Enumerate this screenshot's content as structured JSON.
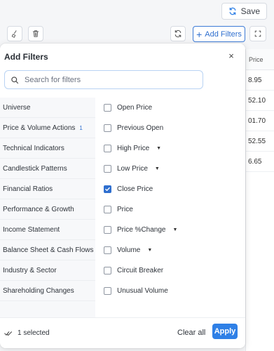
{
  "topbar": {
    "save_label": "Save"
  },
  "toolbar": {
    "add_filters_label": "Add Filters"
  },
  "background_table": {
    "header": "Price",
    "values": [
      "8.95",
      "52.10",
      "01.70",
      "52.55",
      "6.65"
    ]
  },
  "modal": {
    "title": "Add Filters",
    "close_glyph": "×",
    "search_placeholder": "Search for filters",
    "categories": [
      {
        "label": "Universe",
        "badge": ""
      },
      {
        "label": "Price & Volume Actions",
        "badge": "1"
      },
      {
        "label": "Technical Indicators",
        "badge": ""
      },
      {
        "label": "Candlestick Patterns",
        "badge": ""
      },
      {
        "label": "Financial Ratios",
        "badge": ""
      },
      {
        "label": "Performance & Growth",
        "badge": ""
      },
      {
        "label": "Income Statement",
        "badge": ""
      },
      {
        "label": "Balance Sheet & Cash Flows",
        "badge": ""
      },
      {
        "label": "Industry & Sector",
        "badge": ""
      },
      {
        "label": "Shareholding Changes",
        "badge": ""
      }
    ],
    "options": [
      {
        "label": "Open Price",
        "checked": false,
        "dropdown": false
      },
      {
        "label": "Previous Open",
        "checked": false,
        "dropdown": false
      },
      {
        "label": "High Price",
        "checked": false,
        "dropdown": true
      },
      {
        "label": "Low Price",
        "checked": false,
        "dropdown": true
      },
      {
        "label": "Close Price",
        "checked": true,
        "dropdown": false
      },
      {
        "label": "Price",
        "checked": false,
        "dropdown": false
      },
      {
        "label": "Price %Change",
        "checked": false,
        "dropdown": true
      },
      {
        "label": "Volume",
        "checked": false,
        "dropdown": true
      },
      {
        "label": "Circuit Breaker",
        "checked": false,
        "dropdown": false
      },
      {
        "label": "Unusual Volume",
        "checked": false,
        "dropdown": false
      }
    ],
    "footer": {
      "selected_text": "1 selected",
      "clear_label": "Clear all",
      "apply_label": "Apply"
    }
  },
  "colors": {
    "accent": "#2f80e6",
    "link_blue": "#2f6fcf",
    "category_bg": "#f7f8fa"
  },
  "icons": {
    "save": "save-sync-icon",
    "toolbar_left_1": "broom-icon",
    "toolbar_left_2": "trash-icon",
    "refresh": "refresh-icon",
    "search": "search-icon",
    "close": "close-icon",
    "checkmark": "checkmark-icon",
    "selected": "double-check-icon"
  }
}
